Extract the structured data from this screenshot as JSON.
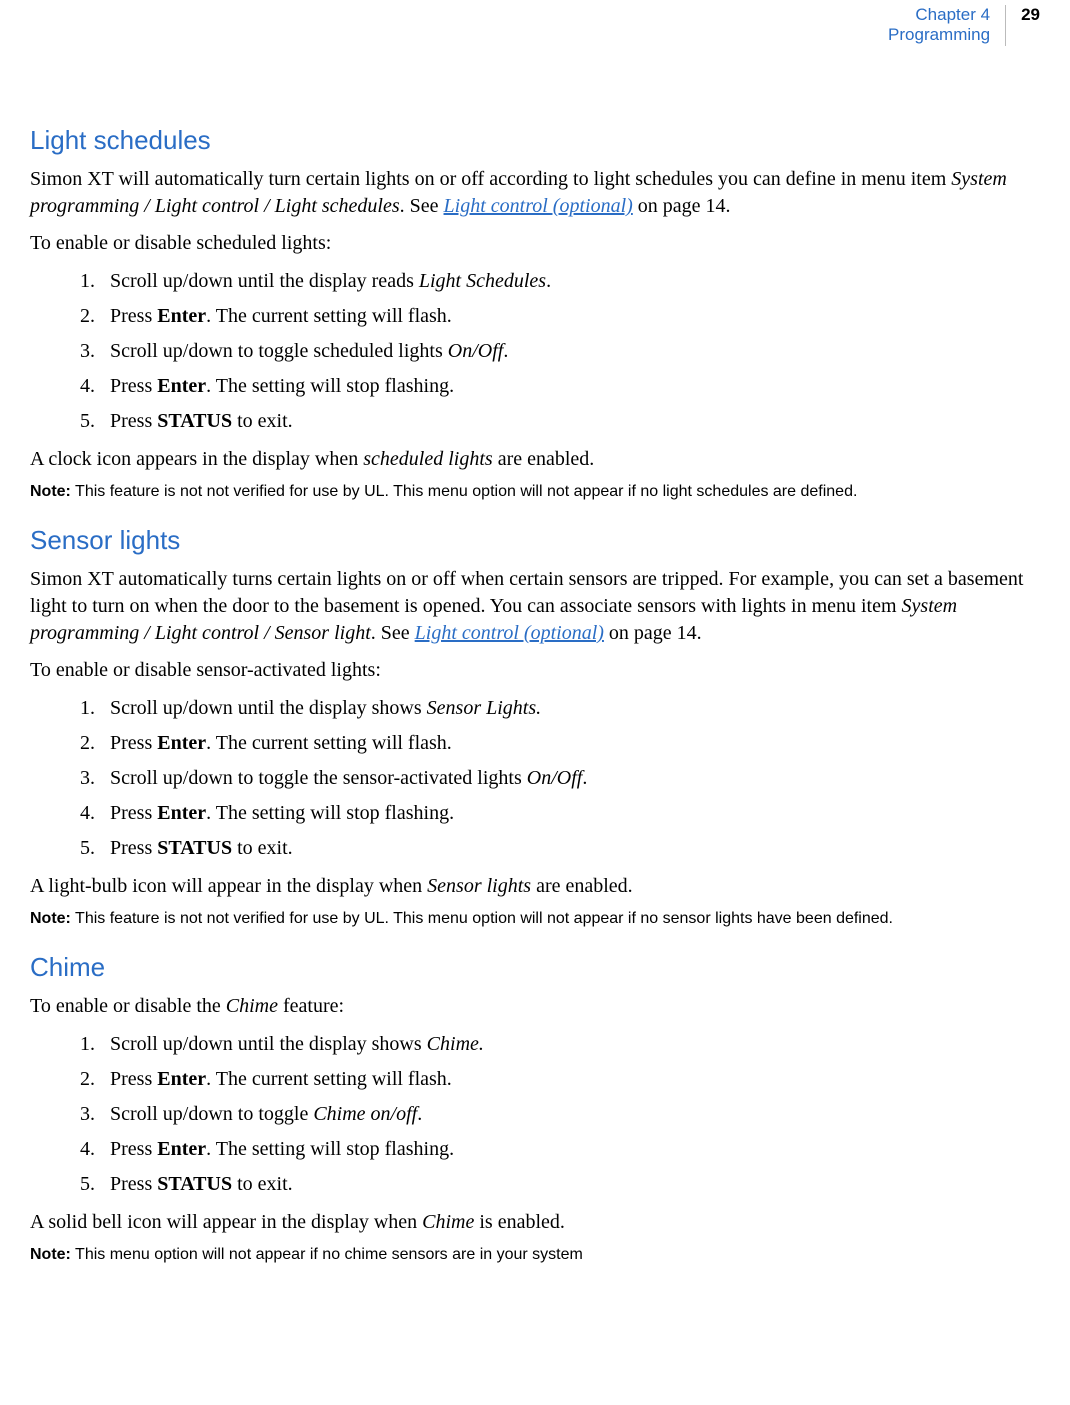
{
  "header": {
    "chapter_line1": "Chapter 4",
    "chapter_line2": "Programming",
    "page_number": "29"
  },
  "sec1": {
    "heading": "Light schedules",
    "p1_a": "Simon XT will automatically turn certain lights on or off according to light schedules you can define in menu item ",
    "p1_i": "System programming / Light control / Light schedules",
    "p1_b": ". See ",
    "p1_link": "Light control (optional)",
    "p1_c": " on page 14.",
    "p2": "To enable or disable scheduled lights:",
    "steps": {
      "s1a": "Scroll up/down until the display reads ",
      "s1i": "Light Schedules",
      "s1b": ".",
      "s2a": "Press ",
      "s2bold": "Enter",
      "s2b": ". The current setting will flash.",
      "s3a": "Scroll up/down to toggle scheduled lights ",
      "s3i": "On/Off",
      "s3b": ".",
      "s4a": "Press ",
      "s4bold": "Enter",
      "s4b": ". The setting will stop flashing.",
      "s5a": "Press ",
      "s5bold": "STATUS",
      "s5b": " to exit."
    },
    "p3a": "A clock icon appears in the display when ",
    "p3i": "scheduled lights",
    "p3b": " are enabled.",
    "note_label": "Note:",
    "note_text": "  This feature is not not verified for use by UL. This menu option will not appear if no light schedules are defined."
  },
  "sec2": {
    "heading": "Sensor lights",
    "p1_a": "Simon XT automatically turns certain lights on or off when certain sensors are tripped. For example, you can set a basement light to turn on when the door to the basement is opened. You can associate sensors with lights in menu item ",
    "p1_i": "System programming / Light control / Sensor light",
    "p1_b": ".  See ",
    "p1_link": "Light control (optional)",
    "p1_c": " on page 14.",
    "p2": "To enable or disable sensor-activated lights:",
    "steps": {
      "s1a": "Scroll up/down until the display shows ",
      "s1i": "Sensor Lights.",
      "s1b": "",
      "s2a": "Press ",
      "s2bold": "Enter",
      "s2b": ". The current setting will flash.",
      "s3a": "Scroll up/down to toggle the sensor-activated lights ",
      "s3i": "On/Off",
      "s3b": ".",
      "s4a": "Press ",
      "s4bold": "Enter",
      "s4b": ". The setting will stop flashing.",
      "s5a": "Press ",
      "s5bold": "STATUS",
      "s5b": " to exit."
    },
    "p3a": "A light-bulb icon will appear in the display when ",
    "p3i": "Sensor lights",
    "p3b": " are enabled.",
    "note_label": "Note:",
    "note_text": "  This feature is not not verified for use by UL. This menu option will not appear if no sensor lights have been defined."
  },
  "sec3": {
    "heading": "Chime",
    "p1a": "To enable or disable the ",
    "p1i": "Chime",
    "p1b": " feature:",
    "steps": {
      "s1a": "Scroll up/down until the display shows ",
      "s1i": "Chime.",
      "s1b": "",
      "s2a": "Press ",
      "s2bold": "Enter",
      "s2b": ". The current setting will flash.",
      "s3a": "Scroll up/down to toggle ",
      "s3i": "Chime on/off",
      "s3b": ".",
      "s4a": "Press ",
      "s4bold": "Enter",
      "s4b": ". The setting will stop flashing.",
      "s5a": "Press ",
      "s5bold": "STATUS",
      "s5b": " to exit."
    },
    "p3a": "A solid bell icon will appear in the display when ",
    "p3i": "Chime",
    "p3b": " is enabled.",
    "note_label": "Note:",
    "note_text": "  This menu option will not appear if no chime sensors are in your system"
  }
}
